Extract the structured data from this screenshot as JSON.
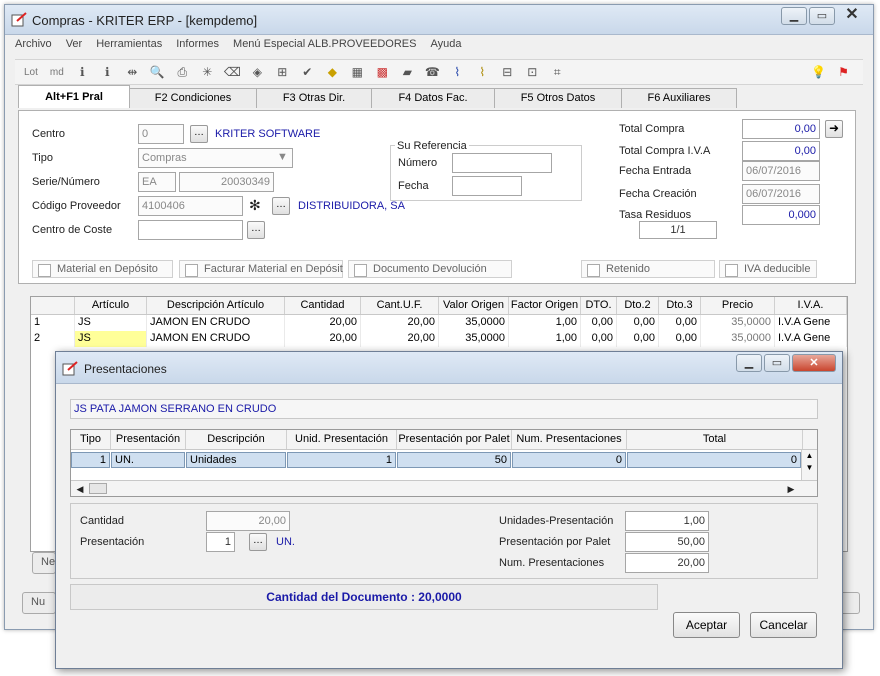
{
  "main_window": {
    "title": "Compras - KRITER ERP - [kempdemo]",
    "menu": [
      "Archivo",
      "Ver",
      "Herramientas",
      "Informes",
      "Menú Especial ALB.PROVEEDORES",
      "Ayuda"
    ],
    "toolbar_text": [
      "Lot",
      "md"
    ],
    "tabs": [
      "Alt+F1 Pral",
      "F2 Condiciones",
      "F3 Otras Dir.",
      "F4 Datos Fac.",
      "F5 Otros Datos",
      "F6 Auxiliares"
    ]
  },
  "form": {
    "centro_label": "Centro",
    "centro_value": "0",
    "centro_name": "KRITER SOFTWARE",
    "tipo_label": "Tipo",
    "tipo_value": "Compras",
    "serie_label": "Serie/Número",
    "serie_value": "EA",
    "numero_value": "20030349",
    "proveedor_label": "Código Proveedor",
    "proveedor_value": "4100406",
    "proveedor_name": "DISTRIBUIDORA, SA",
    "coste_label": "Centro de Coste",
    "coste_value": "",
    "su_ref_title": "Su Referencia",
    "su_ref_numero_label": "Número",
    "su_ref_fecha_label": "Fecha",
    "total_compra_label": "Total Compra",
    "total_compra_value": "0,00",
    "total_iva_label": "Total Compra I.V.A",
    "total_iva_value": "0,00",
    "fecha_entrada_label": "Fecha Entrada",
    "fecha_entrada_value": "06/07/2016",
    "fecha_creacion_label": "Fecha Creación",
    "fecha_creacion_value": "06/07/2016",
    "tasa_label": "Tasa Residuos",
    "tasa_value": "0,000",
    "page_indicator": "1/1"
  },
  "checkboxes": [
    "Material en Depósito",
    "Facturar Material en Depósit",
    "Documento Devolución",
    "Retenido",
    "IVA deducible"
  ],
  "lines_grid": {
    "columns": [
      "",
      "Artículo",
      "Descripción Artículo",
      "Cantidad",
      "Cant.U.F.",
      "Valor Origen",
      "Factor Origen",
      "DTO.",
      "Dto.2",
      "Dto.3",
      "Precio",
      "I.V.A."
    ],
    "rows": [
      [
        "1",
        "JS",
        "JAMON EN CRUDO",
        "20,00",
        "20,00",
        "35,0000",
        "1,00",
        "0,00",
        "0,00",
        "0,00",
        "35,0000",
        "I.V.A Gene"
      ],
      [
        "2",
        "JS",
        "JAMON EN CRUDO",
        "20,00",
        "20,00",
        "35,0000",
        "1,00",
        "0,00",
        "0,00",
        "0,00",
        "35,0000",
        "I.V.A Gene"
      ]
    ]
  },
  "background_buttons": [
    "Nu",
    "Ne"
  ],
  "dialog": {
    "title": "Presentaciones",
    "article_line": "JS  PATA JAMON SERRANO EN CRUDO",
    "columns": [
      "Tipo",
      "Presentación",
      "Descripción",
      "Unid. Presentación",
      "Presentación por Palet",
      "Num. Presentaciones",
      "Total"
    ],
    "rows": [
      [
        "1",
        "UN.",
        "Unidades",
        "1",
        "50",
        "0",
        "0"
      ]
    ],
    "cantidad_label": "Cantidad",
    "cantidad_value": "20,00",
    "presentacion_label": "Presentación",
    "presentacion_value": "1",
    "presentacion_code": "UN.",
    "unidades_pres_label": "Unidades-Presentación",
    "unidades_pres_value": "1,00",
    "pres_palet_label": "Presentación por Palet",
    "pres_palet_value": "50,00",
    "num_pres_label": "Num. Presentaciones",
    "num_pres_value": "20,00",
    "status_text": "Cantidad del Documento : 20,0000",
    "accept_label": "Aceptar",
    "cancel_label": "Cancelar"
  }
}
